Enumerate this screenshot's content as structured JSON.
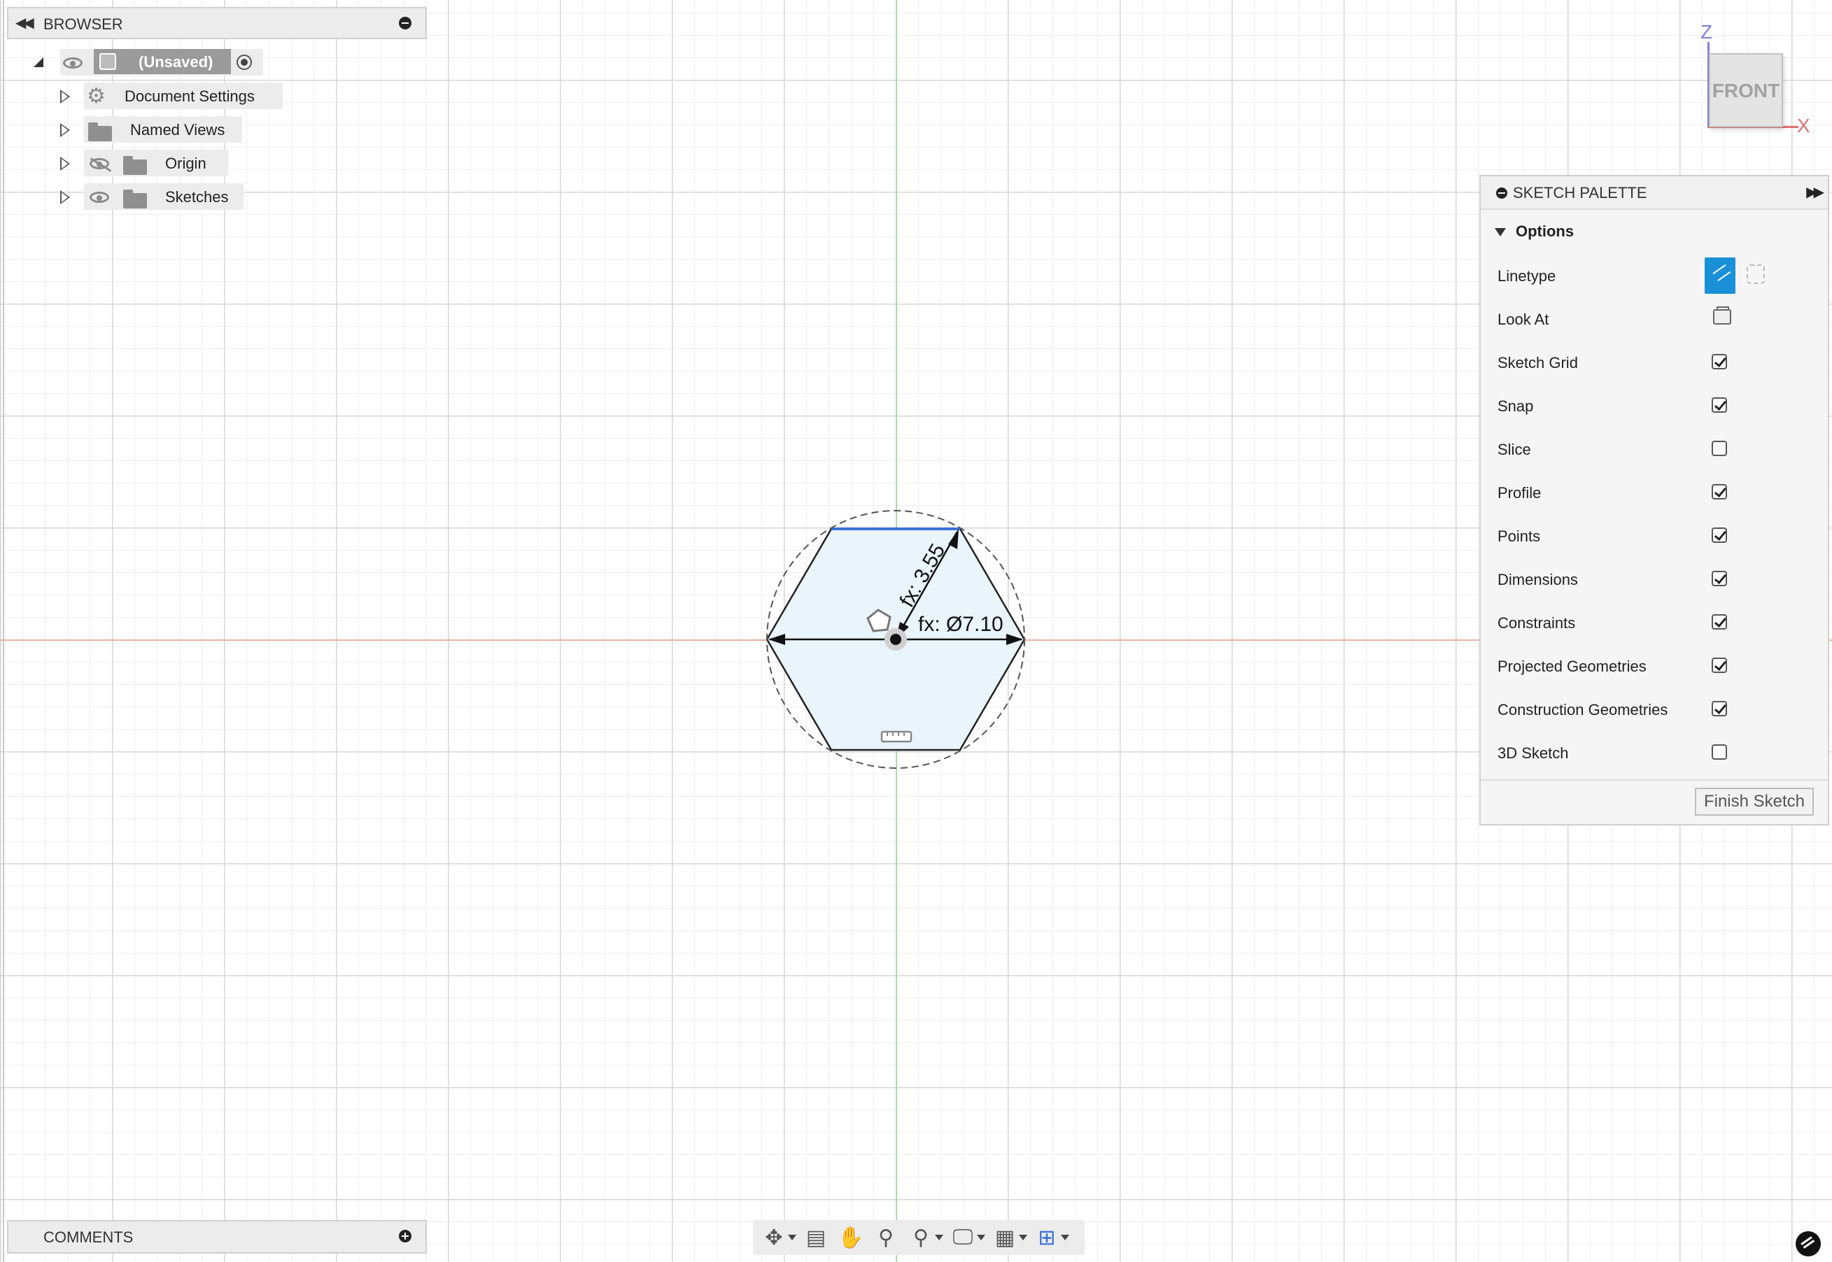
{
  "browser": {
    "title": "BROWSER",
    "root": {
      "label": "(Unsaved)"
    },
    "items": [
      {
        "label": "Document Settings",
        "icon": "gear-icon"
      },
      {
        "label": "Named Views",
        "icon": "folder-icon"
      },
      {
        "label": "Origin",
        "icon": "folder-icon",
        "visible": false
      },
      {
        "label": "Sketches",
        "icon": "folder-icon",
        "visible": true
      }
    ]
  },
  "sketch": {
    "radius_label": "fx: 3.55",
    "diameter_label": "fx: Ø7.10",
    "shape": "hexagon",
    "colors": {
      "fill": "#e9f4fb",
      "selected_edge": "#3a6fd8",
      "edge": "#222222"
    }
  },
  "viewcube": {
    "face": "FRONT",
    "z_label": "Z",
    "x_label": "X",
    "z_color": "#8080e0",
    "x_color": "#e07070"
  },
  "palette": {
    "title": "SKETCH PALETTE",
    "section": "Options",
    "options": [
      {
        "label": "Linetype",
        "control": "linetype"
      },
      {
        "label": "Look At",
        "control": "lookat"
      },
      {
        "label": "Sketch Grid",
        "checked": true
      },
      {
        "label": "Snap",
        "checked": true
      },
      {
        "label": "Slice",
        "checked": false
      },
      {
        "label": "Profile",
        "checked": true
      },
      {
        "label": "Points",
        "checked": true
      },
      {
        "label": "Dimensions",
        "checked": true
      },
      {
        "label": "Constraints",
        "checked": true
      },
      {
        "label": "Projected Geometries",
        "checked": true
      },
      {
        "label": "Construction Geometries",
        "checked": true
      },
      {
        "label": "3D Sketch",
        "checked": false
      }
    ],
    "finish_label": "Finish Sketch",
    "accent": "#1a90d8"
  },
  "comments": {
    "title": "COMMENTS"
  },
  "toolbar": {
    "icons": [
      "orbit-icon",
      "look-at-icon",
      "pan-icon",
      "zoom-icon",
      "zoom-window-icon",
      "display-settings-icon",
      "grid-settings-icon",
      "viewports-icon"
    ]
  }
}
